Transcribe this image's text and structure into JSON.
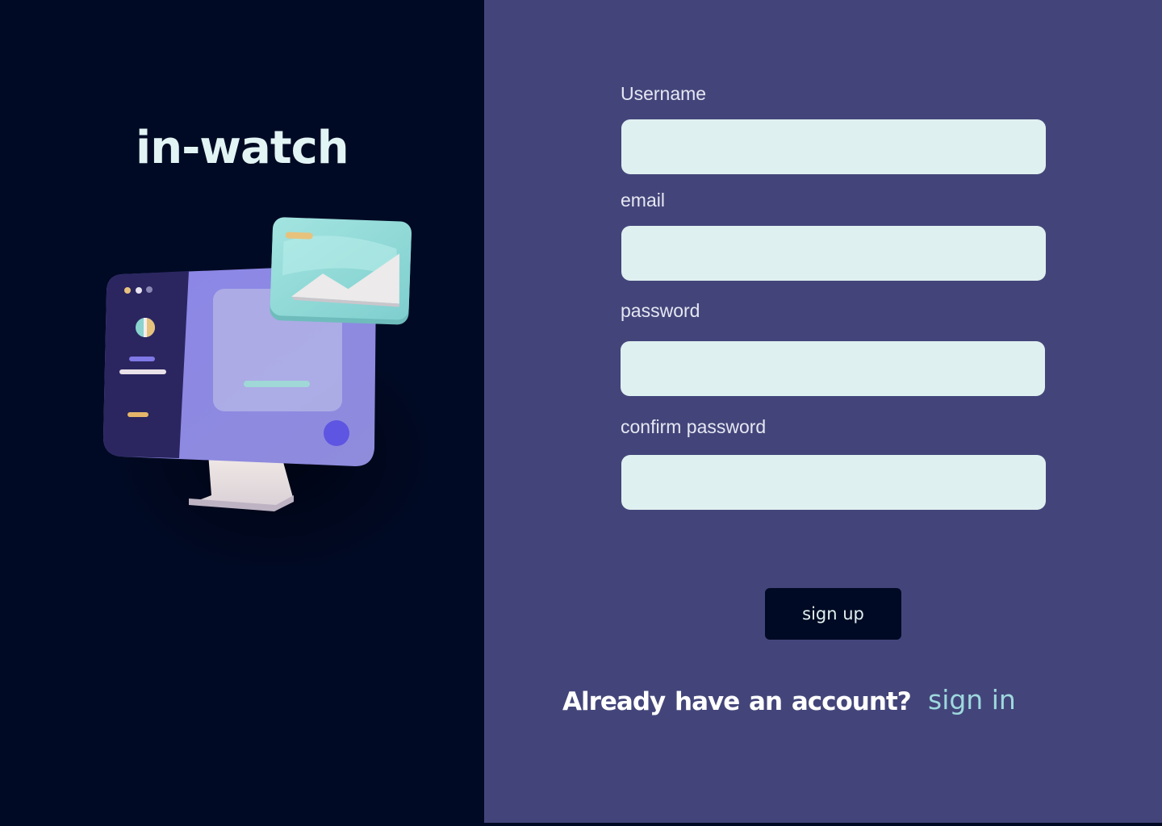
{
  "brand": {
    "name": "in-watch"
  },
  "form": {
    "fields": [
      {
        "label": "Username",
        "value": "",
        "placeholder": ""
      },
      {
        "label": "email",
        "value": "",
        "placeholder": ""
      },
      {
        "label": "password",
        "value": "",
        "placeholder": ""
      },
      {
        "label": "confirm password",
        "value": "",
        "placeholder": ""
      }
    ],
    "submit_label": "sign up"
  },
  "signin_prompt": {
    "question": "Already  have an account?",
    "link_label": "sign in"
  },
  "colors": {
    "left_background": "#010a24",
    "right_background": "#43457a",
    "input_background": "#dff0f0",
    "button_background": "#010a24",
    "link": "#9ed8de",
    "brand_text": "#e2f4f4"
  },
  "illustration": {
    "icon": "computer-monitor-illustration"
  }
}
